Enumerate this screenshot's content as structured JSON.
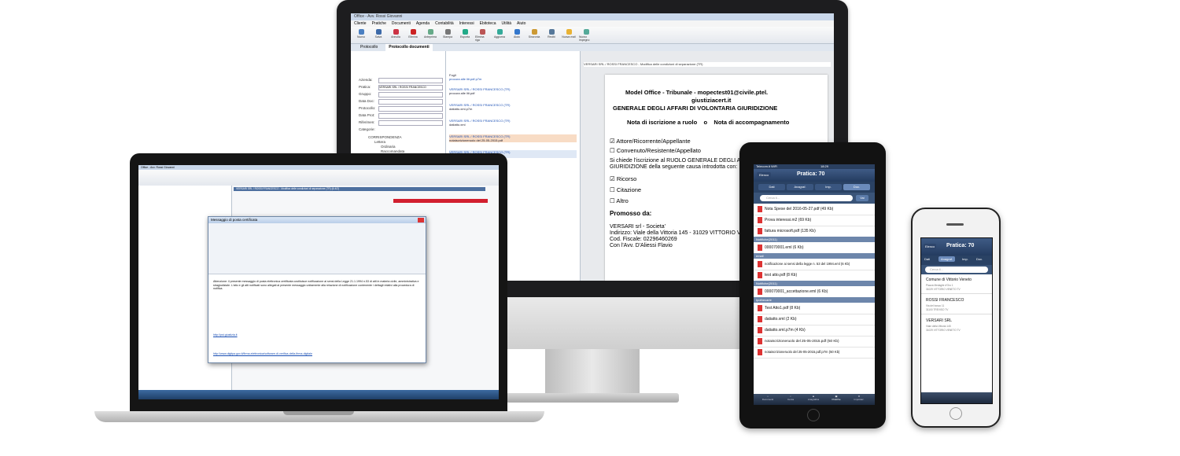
{
  "desktop": {
    "window_title": "Office - Avv. Rossi Giovanni",
    "menu": [
      "Cliente",
      "Pratiche",
      "Documenti",
      "Agenda",
      "Contabilità",
      "Interessi",
      "Ebitoteca",
      "Utilità",
      "Aiuto"
    ],
    "toolbar": [
      "Nuovo",
      "Salva",
      "Annulla",
      "Elimina",
      "Anteprima",
      "Stampa",
      "Esporta",
      "Elimina riga",
      "Aggiorna",
      "Aiuto",
      "Sincronia",
      "Recibi",
      "Nuova mail",
      "Nuovo impegno"
    ],
    "tabs": [
      "Protocollo",
      "Protocollo documenti"
    ],
    "left_fields": [
      "Azienda:",
      "Pratica:",
      "Gruppo:",
      "Data Doc:",
      "Protocollo:",
      "Data Prot:",
      "Riferimen:",
      "Categorie:"
    ],
    "pratica_value": "VERSARI SRL / ROSSI FRANCESCO",
    "tree": [
      "CORRISPONDENZA",
      "Lettera",
      "Ordinaria",
      "Raccomandata",
      "Fax",
      "E-mail",
      "PEC"
    ],
    "mid_items": [
      {
        "title": "Fogli",
        "file": "procura alle liti.pdf.p7m"
      },
      {
        "title": "VERSARI SRL / ROSSI FRANCESCO (TR)",
        "file": "procura alle liti.pdf"
      },
      {
        "title": "VERSARI SRL / ROSSI FRANCESCO (TR)",
        "file": "datiatto.xml.p7m"
      },
      {
        "title": "VERSARI SRL / ROSSI FRANCESCO (TR)",
        "file": "datiatto.xml"
      },
      {
        "title": "VERSARI SRL / ROSSI FRANCESCO (TR)",
        "file": "notaiscrizioneruolo del 25-05-2015.pdf"
      },
      {
        "title": "VERSARI SRL / ROSSI FRANCESCO (TR)",
        "file": "notaiscrizioneruolo del 25-05-2015.pdf"
      }
    ],
    "right_header": "VERSARI SRL / ROSSI FRANCESCO - Modifica delle condizioni di separazione (TR)",
    "document": {
      "line1": "Model Office - Tribunale - mopectest01@civile.ptel.",
      "line2": "giustiziacert.it",
      "line3": "GENERALE DEGLI AFFARI DI VOLONTARIA GIURIDIZIONE",
      "line4": "Nota di iscrizione a ruolo    o    Nota di accompagnamento",
      "opt1": "Attore/Ricorrente/Appellante",
      "opt2": "Convenuto/Resistente/Appellato",
      "para1": "Si chiede l'iscrizione al RUOLO GENERALE DEGLI AFF",
      "para2": "GIURIDIZIONE della seguente causa introdotta con:",
      "opt3": "Ricorso",
      "opt4": "Citazione",
      "opt5": "Altro",
      "promosso": "Promosso da:",
      "p1": "VERSARI srl - Societa'",
      "p2": "Indirizzo: Viale della Vittoria 145 - 31029 VITTORIO VE",
      "p3": "Cod. Fiscale: 02296460269",
      "p4": "Con l'Avv. D'Aliessi Flavio"
    }
  },
  "laptop": {
    "window_title": "Office - Avv. Rossi Giovanni",
    "header": "VERSARI SRL / ROSSI FRANCESCO - Modifica delle condizioni di separazione (TR) (6-4/2)",
    "dialog_title": "Messaggio di posta certificata",
    "dialog_text": "Attenzione: il presente messaggio di posta elettronica certificata costituisce notificazione ai sensi della Legge 21.1.1994 n.53 di atti in materia civile, amministrativa e stragiudiziale. L'atto e gli atti notificati sono allegati al presente messaggio unitamente alla relazione di notificazione contenente i dettagli relativi alla procedura di notifica.",
    "dialog_links": [
      "http://pst.giustizia.it",
      "http://www.digitpa.gov.it/firma-elettronica/software-di-verifica-della-firma-digitale"
    ]
  },
  "ipad": {
    "status_left": "Telecom.it WiFi",
    "status_time": "18:29",
    "back": "Elenco",
    "title": "Pratica: 70",
    "segments": [
      "Dati",
      "Anagraf.",
      "Imp.",
      "Doc."
    ],
    "search_placeholder": "Cerca il...",
    "search_btn": "Vai",
    "rows": [
      {
        "type": "row",
        "text": "Nota Spese del 2016-05-27.pdf (49 Kb)"
      },
      {
        "type": "row",
        "text": "Prova interessi.m2 (69 Kb)"
      },
      {
        "type": "row",
        "text": "fattura microsoft.pdf (135 Kb)"
      },
      {
        "type": "hdr",
        "text": "Notifiche(2011)"
      },
      {
        "type": "row",
        "text": "000070001.eml (6 Kb)"
      },
      {
        "type": "hdr",
        "text": "email"
      },
      {
        "type": "row",
        "text": "notificazione ai sensi della legge n. 53 del 1994.eml (6 Kb)"
      },
      {
        "type": "row",
        "text": "test atto.pdf (8 Kb)"
      },
      {
        "type": "hdr",
        "text": "Notifiche(2011)"
      },
      {
        "type": "row",
        "text": "000070001_accettazione.eml (6 Kb)"
      },
      {
        "type": "hdr",
        "text": "Ipothecarie"
      },
      {
        "type": "row",
        "text": "Test Atto1.pdf (8 Kb)"
      },
      {
        "type": "row",
        "text": "datiatto.xml (2 Kb)"
      },
      {
        "type": "row",
        "text": "datiatto.xml.p7m (4 Kb)"
      },
      {
        "type": "row",
        "text": "notaiscrizioneruolo del 25-05-2015.pdf (50 Kb)"
      },
      {
        "type": "row",
        "text": "notaiscrizioneruolo del 25-05-2015.pdf.p7m (50 Kb)"
      }
    ],
    "tabbar": [
      "Documenti",
      "Cerca",
      "Anagrafica",
      "Pratiche",
      "Impostaz."
    ]
  },
  "iphone": {
    "back": "Elenco",
    "title": "Pratica: 70",
    "segments": [
      "Dati",
      "Anagraf.",
      "Imp.",
      "Doc."
    ],
    "search_placeholder": "Cerca il...",
    "items": [
      {
        "name": "Comune di Vittorio Veneto",
        "sub1": "Piazza Medaglie d'Oro 1",
        "sub2": "31029 VITTORIO VENETO TV"
      },
      {
        "name": "ROSSI FRANCESCO",
        "sub1": "Via del bosco 11",
        "sub2": "31100 TREVISO TV"
      },
      {
        "name": "VERSARI SRL",
        "sub1": "Viale della Vittoria 145",
        "sub2": "31029 VITTORIO VENETO TV"
      }
    ]
  },
  "colors": {
    "accent": "#2b4a74",
    "pdf": "#d33333",
    "link": "#1a4fb4"
  }
}
